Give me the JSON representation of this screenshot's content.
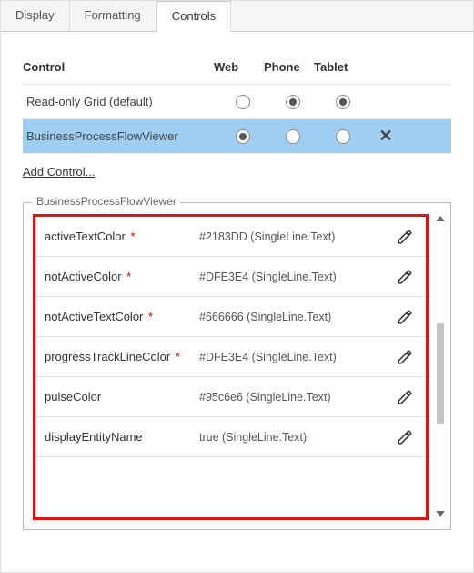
{
  "tabs": [
    "Display",
    "Formatting",
    "Controls"
  ],
  "activeTabIndex": 2,
  "columns": {
    "control": "Control",
    "web": "Web",
    "phone": "Phone",
    "tablet": "Tablet"
  },
  "controls": [
    {
      "name": "Read-only Grid (default)",
      "web": false,
      "phone": true,
      "tablet": true,
      "selected": false,
      "removable": false
    },
    {
      "name": "BusinessProcessFlowViewer",
      "web": true,
      "phone": false,
      "tablet": false,
      "selected": true,
      "removable": true
    }
  ],
  "addControlLabel": "Add Control...",
  "propsTitle": "BusinessProcessFlowViewer",
  "properties": [
    {
      "name": "activeTextColor",
      "required": true,
      "value": "#2183DD (SingleLine.Text)"
    },
    {
      "name": "notActiveColor",
      "required": true,
      "value": "#DFE3E4 (SingleLine.Text)"
    },
    {
      "name": "notActiveTextColor",
      "required": true,
      "value": "#666666 (SingleLine.Text)"
    },
    {
      "name": "progressTrackLineColor",
      "required": true,
      "value": "#DFE3E4 (SingleLine.Text)"
    },
    {
      "name": "pulseColor",
      "required": false,
      "value": "#95c6e6 (SingleLine.Text)"
    },
    {
      "name": "displayEntityName",
      "required": false,
      "value": "true (SingleLine.Text)"
    }
  ],
  "requiredMark": "*"
}
